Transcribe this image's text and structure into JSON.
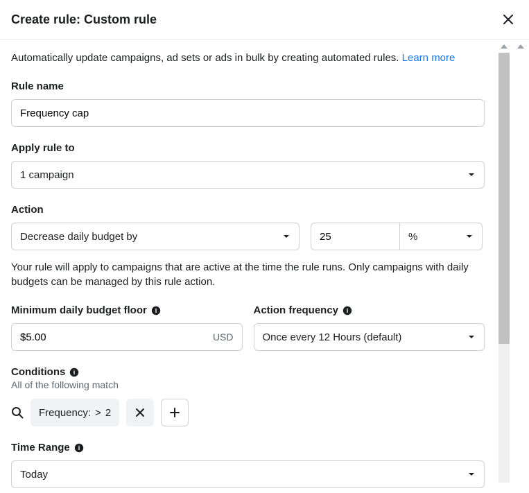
{
  "header": {
    "title": "Create rule: Custom rule"
  },
  "intro": {
    "text": "Automatically update campaigns, ad sets or ads in bulk by creating automated rules. ",
    "learn_more": "Learn more"
  },
  "rule_name": {
    "label": "Rule name",
    "value": "Frequency cap"
  },
  "apply_to": {
    "label": "Apply rule to",
    "value": "1 campaign"
  },
  "action": {
    "label": "Action",
    "type": "Decrease daily budget by",
    "amount": "25",
    "unit": "%",
    "helper": "Your rule will apply to campaigns that are active at the time the rule runs. Only campaigns with daily budgets can be managed by this rule action."
  },
  "min_floor": {
    "label": "Minimum daily budget floor",
    "value": "$5.00",
    "currency": "USD"
  },
  "frequency": {
    "label": "Action frequency",
    "value": "Once every 12 Hours (default)"
  },
  "conditions": {
    "label": "Conditions",
    "subtext": "All of the following match",
    "chip": {
      "field": "Frequency:",
      "op": ">",
      "val": "2"
    }
  },
  "time_range": {
    "label": "Time Range",
    "value": "Today"
  }
}
